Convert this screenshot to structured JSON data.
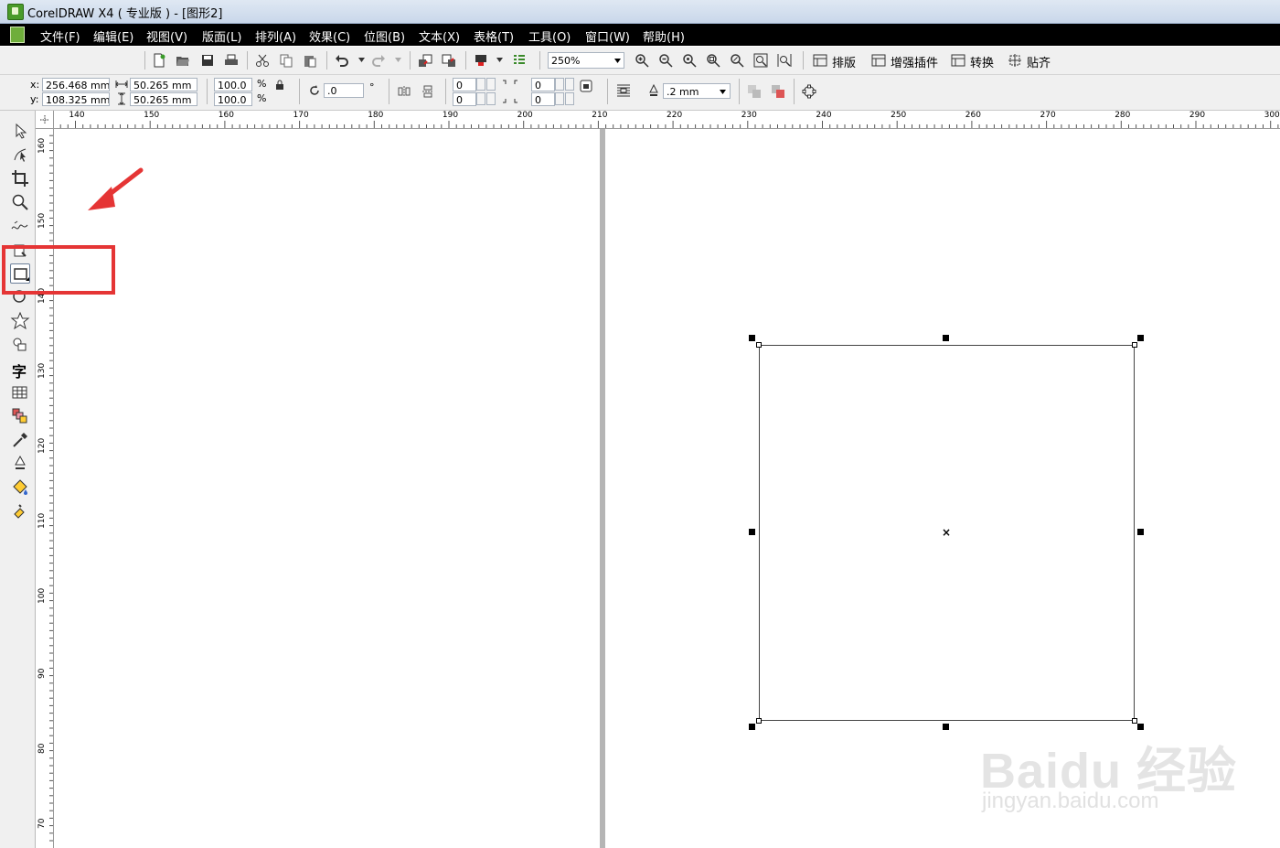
{
  "window": {
    "title": "CorelDRAW X4 ( 专业版 ) - [图形2]"
  },
  "menu": [
    "文件(F)",
    "编辑(E)",
    "视图(V)",
    "版面(L)",
    "排列(A)",
    "效果(C)",
    "位图(B)",
    "文本(X)",
    "表格(T)",
    "工具(O)",
    "窗口(W)",
    "帮助(H)"
  ],
  "toolbar": {
    "zoom_value": "250%",
    "buttons": [
      "排版",
      "增强插件",
      "转换",
      "贴齐"
    ]
  },
  "property_bar": {
    "x_label": "x:",
    "x_value": "256.468 mm",
    "y_label": "y:",
    "y_value": "108.325 mm",
    "width_value": "50.265 mm",
    "height_value": "50.265 mm",
    "scale_x": "100.0",
    "scale_y": "100.0",
    "percent_symbol": "%",
    "rotation": ".0",
    "degree_symbol": "°",
    "corner_1": "0",
    "corner_2": "0",
    "corner_3": "0",
    "corner_4": "0",
    "outline_width": ".2 mm"
  },
  "rulers": {
    "horizontal": [
      "140",
      "150",
      "160",
      "170",
      "180",
      "190",
      "200",
      "210",
      "220",
      "230",
      "240",
      "250",
      "260",
      "270",
      "280",
      "290",
      "300"
    ],
    "vertical": [
      "160",
      "150",
      "140",
      "130",
      "120",
      "110",
      "100",
      "90",
      "80",
      "70"
    ]
  },
  "toolbox": {
    "text_tool_glyph": "字",
    "selected_tool": "rectangle-tool"
  },
  "canvas": {
    "center_marker": "×"
  },
  "watermark": {
    "main": "Baidu 经验",
    "sub": "jingyan.baidu.com"
  },
  "colors": {
    "menubar": "#000000",
    "highlight_red": "#e53535",
    "app_green": "#4a9b2a"
  }
}
